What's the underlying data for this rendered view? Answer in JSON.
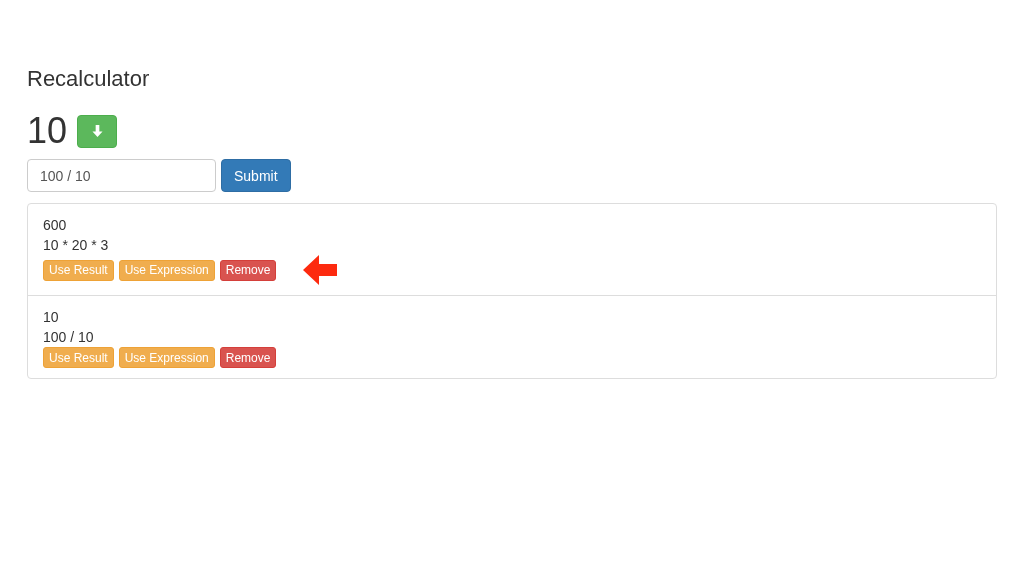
{
  "title": "Recalculator",
  "current": "10",
  "input": {
    "value": "100 / 10"
  },
  "submit": "Submit",
  "results": [
    {
      "result": "600",
      "expression": "10 * 20 * 3",
      "buttons": [
        "Use Result",
        "Use Expression",
        "Remove"
      ],
      "pointed": true
    },
    {
      "result": "10",
      "expression": "100 / 10",
      "buttons": [
        "Use Result",
        "Use Expression",
        "Remove"
      ],
      "pointed": false
    }
  ]
}
